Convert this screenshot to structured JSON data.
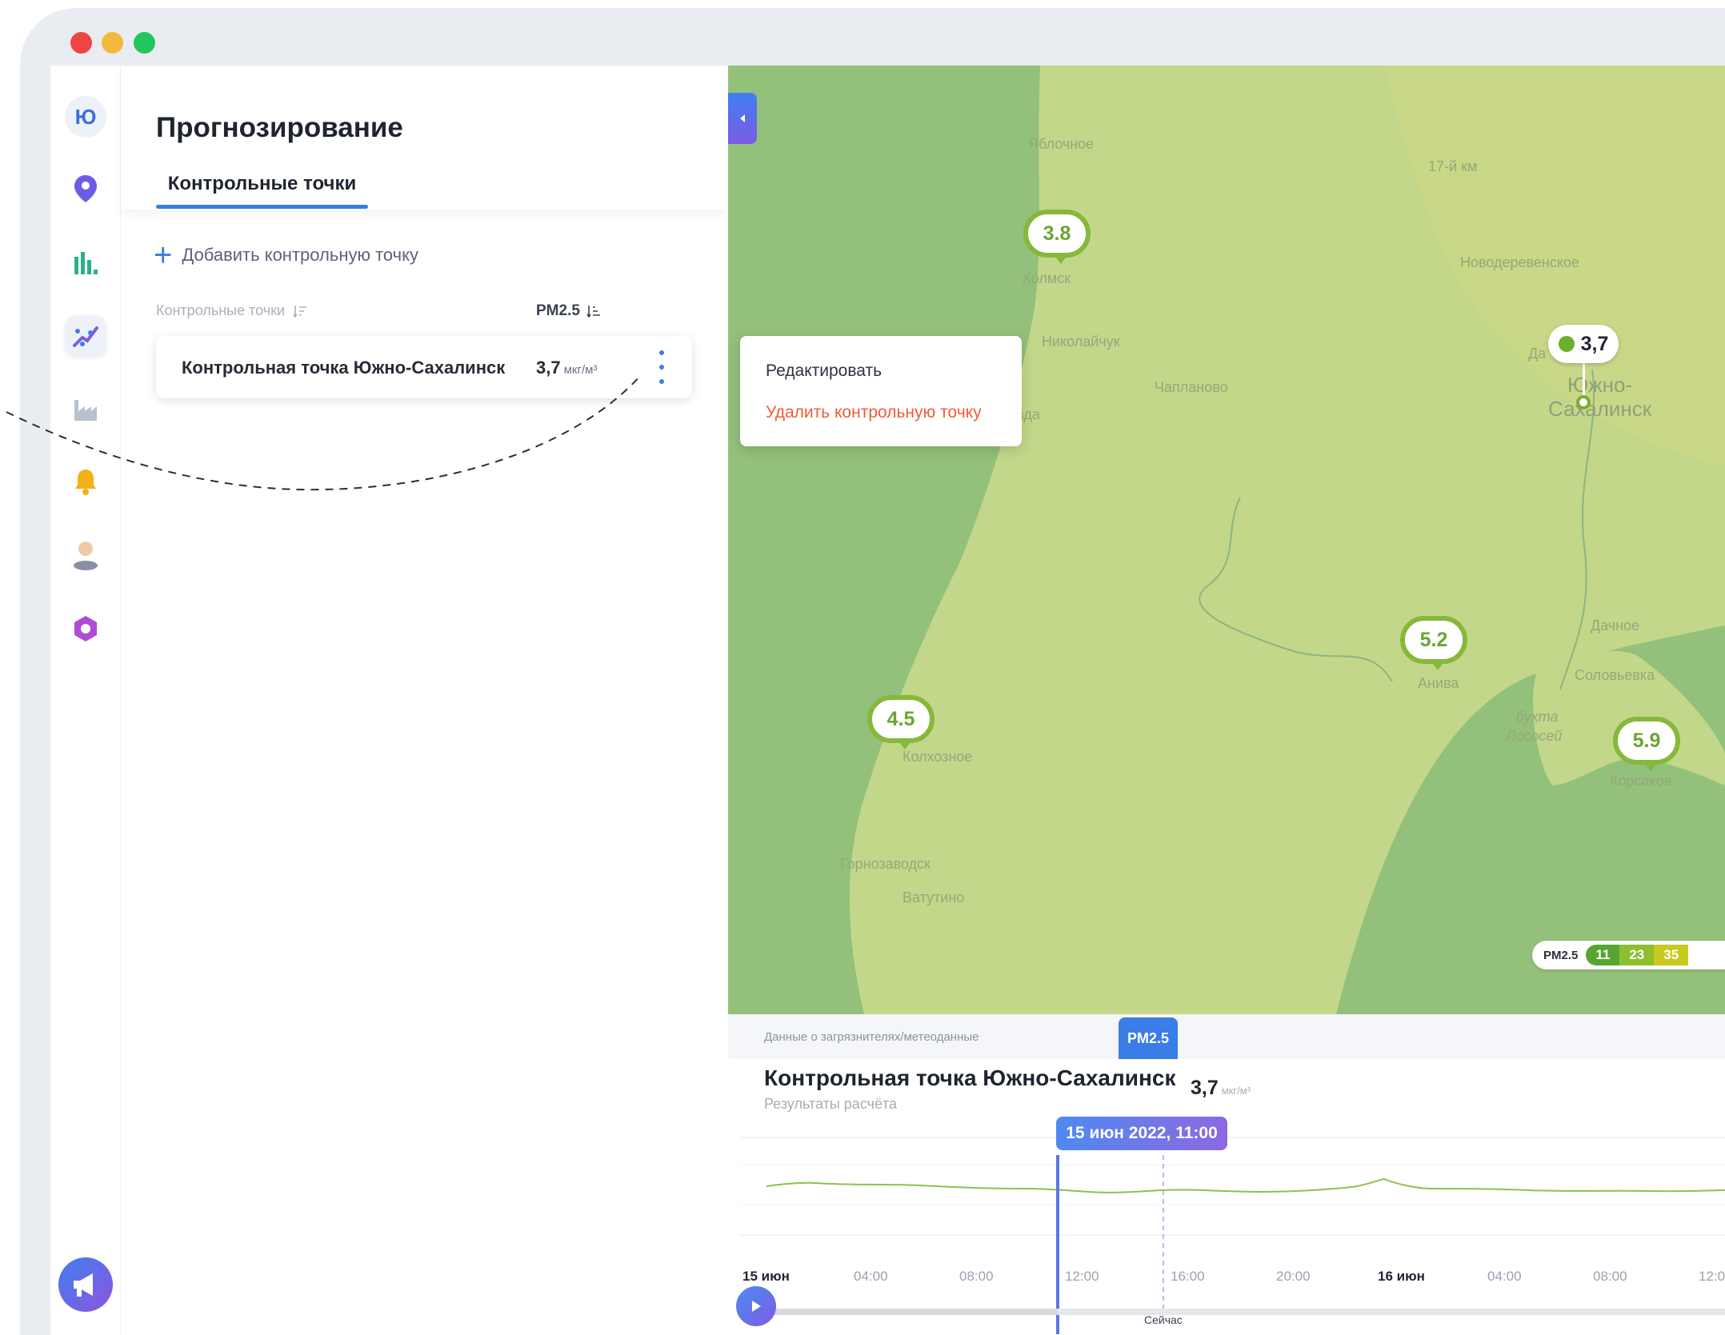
{
  "app": {
    "user_initial": "Ю"
  },
  "rail": {
    "icons": [
      "location-pin-icon",
      "bar-chart-icon",
      "forecast-icon",
      "factory-icon",
      "bell-icon",
      "user-icon",
      "settings-hex-icon",
      "megaphone-icon"
    ],
    "active": "forecast-icon"
  },
  "panel": {
    "title": "Прогнозирование",
    "tab": "Контрольные точки",
    "add_label": "Добавить контрольную точку",
    "col_name": "Контрольные точки",
    "col_value": "PM2.5",
    "points": [
      {
        "name": "Контрольная точка Южно-Сахалинск",
        "value": "3,7",
        "unit": "мкг/м³"
      }
    ]
  },
  "context_menu": {
    "edit": "Редактировать",
    "delete": "Удалить контрольную точку"
  },
  "map": {
    "markers": [
      "3.8",
      "5.2",
      "4.5",
      "5.9"
    ],
    "selected_value": "3,7",
    "labels": {
      "yablochnoe": "Яблочное",
      "kholmsk": "Холмск",
      "nikolaychuk": "Николайчук",
      "chaplanovo": "Чапланово",
      "km17": "17-й км",
      "novoderevenskoe": "Новодеревенское",
      "da": "Да",
      "yuzhno1": "Южно-",
      "yuzhno2": "Сахалинск",
      "dachnoe": "Дачное",
      "solovyovka": "Соловьевка",
      "aniva": "Анива",
      "bukhta1": "бухта",
      "bukhta2": "Лососей",
      "korsakov": "Корсаков",
      "kolkhoznoe": "Колхозное",
      "gornozavodsk": "Горнозаводск",
      "vatutino": "Ватутино",
      "vda": "вда"
    },
    "legend": {
      "label": "PM2.5",
      "steps": [
        "11",
        "23",
        "35"
      ],
      "colors": [
        "#55a630",
        "#8dbf2f",
        "#c8c91f"
      ]
    }
  },
  "bottom": {
    "data_tab_label": "Данные о загрязнителях/метеоданные",
    "pm_tab": "PM2.5",
    "title": "Контрольная точка Южно-Сахалинск",
    "subtitle": "Результаты расчёта",
    "value": "3,7",
    "unit": "мкг/м³",
    "tooltip": "15 июн 2022, 11:00",
    "now_label": "Сейчас",
    "ticks": [
      "15 июн",
      "04:00",
      "08:00",
      "12:00",
      "16:00",
      "20:00",
      "16 июн",
      "04:00",
      "08:00",
      "12:0"
    ]
  }
}
